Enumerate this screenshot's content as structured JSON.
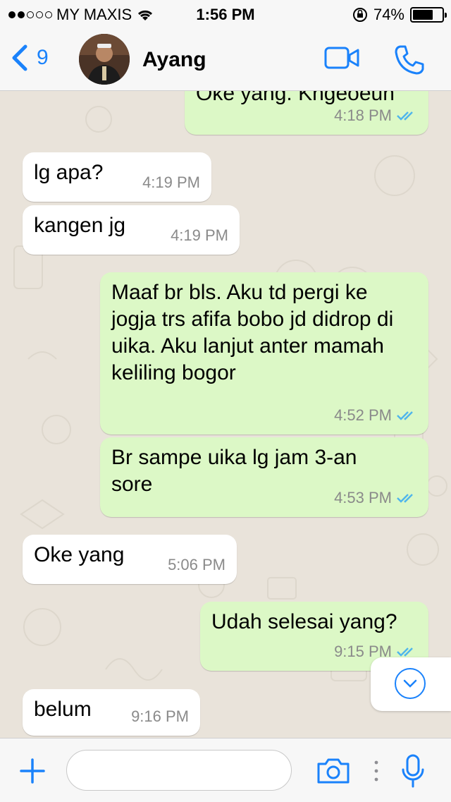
{
  "status_bar": {
    "carrier": "MY MAXIS",
    "time": "1:56 PM",
    "battery": "74%",
    "battery_level": 0.74,
    "signal_bars": 2
  },
  "header": {
    "back_count": "9",
    "contact_name": "Ayang",
    "icons": [
      "chevron-left-icon",
      "video-call-icon",
      "phone-icon"
    ]
  },
  "messages": [
    {
      "direction": "out",
      "text": "Oke yang. Kngeoeun",
      "time": "4:18 PM",
      "read": true
    },
    {
      "direction": "in",
      "text": "lg apa?",
      "time": "4:19 PM"
    },
    {
      "direction": "in",
      "text": "kangen jg",
      "time": "4:19 PM"
    },
    {
      "direction": "out",
      "text": "Maaf br bls. Aku td pergi ke jogja trs afifa bobo jd didrop di uika. Aku lanjut anter mamah keliling bogor",
      "time": "4:52 PM",
      "read": true
    },
    {
      "direction": "out",
      "text": "Br sampe uika lg jam 3-an sore",
      "time": "4:53 PM",
      "read": true
    },
    {
      "direction": "in",
      "text": "Oke yang",
      "time": "5:06 PM"
    },
    {
      "direction": "out",
      "text": "Udah selesai yang?",
      "time": "9:15 PM",
      "read": true
    },
    {
      "direction": "in",
      "text": "belum",
      "time": "9:16 PM"
    }
  ],
  "input": {
    "placeholder": ""
  },
  "colors": {
    "accent": "#1a82fb",
    "outgoing_bubble": "#dcf8c6",
    "incoming_bubble": "#ffffff",
    "chat_bg": "#e9e3da",
    "read_ticks": "#4fb5ec"
  }
}
